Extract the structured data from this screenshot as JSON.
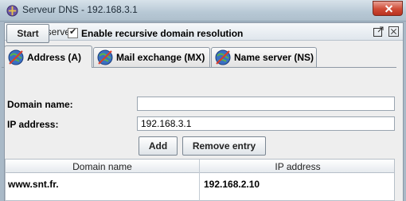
{
  "window": {
    "title": "Serveur DNS - 192.168.3.1"
  },
  "frame": {
    "title": "DNS server"
  },
  "toolbar": {
    "start_label": "Start",
    "recursive_checked": true,
    "recursive_label": "Enable recursive domain resolution"
  },
  "tabs": [
    {
      "label": "Address (A)",
      "active": true
    },
    {
      "label": "Mail exchange (MX)",
      "active": false
    },
    {
      "label": "Name server (NS)",
      "active": false
    }
  ],
  "form": {
    "domain_label": "Domain name:",
    "domain_value": "",
    "ip_label": "IP address:",
    "ip_value": "192.168.3.1",
    "add_label": "Add",
    "remove_label": "Remove entry"
  },
  "table": {
    "columns": [
      "Domain name",
      "IP address"
    ],
    "rows": [
      {
        "domain": "www.snt.fr.",
        "ip": "192.168.2.10"
      }
    ]
  },
  "colors": {
    "os_close": "#cf4b36",
    "panel_bg": "#eeeeee",
    "desktop": "#a9b9c7"
  }
}
